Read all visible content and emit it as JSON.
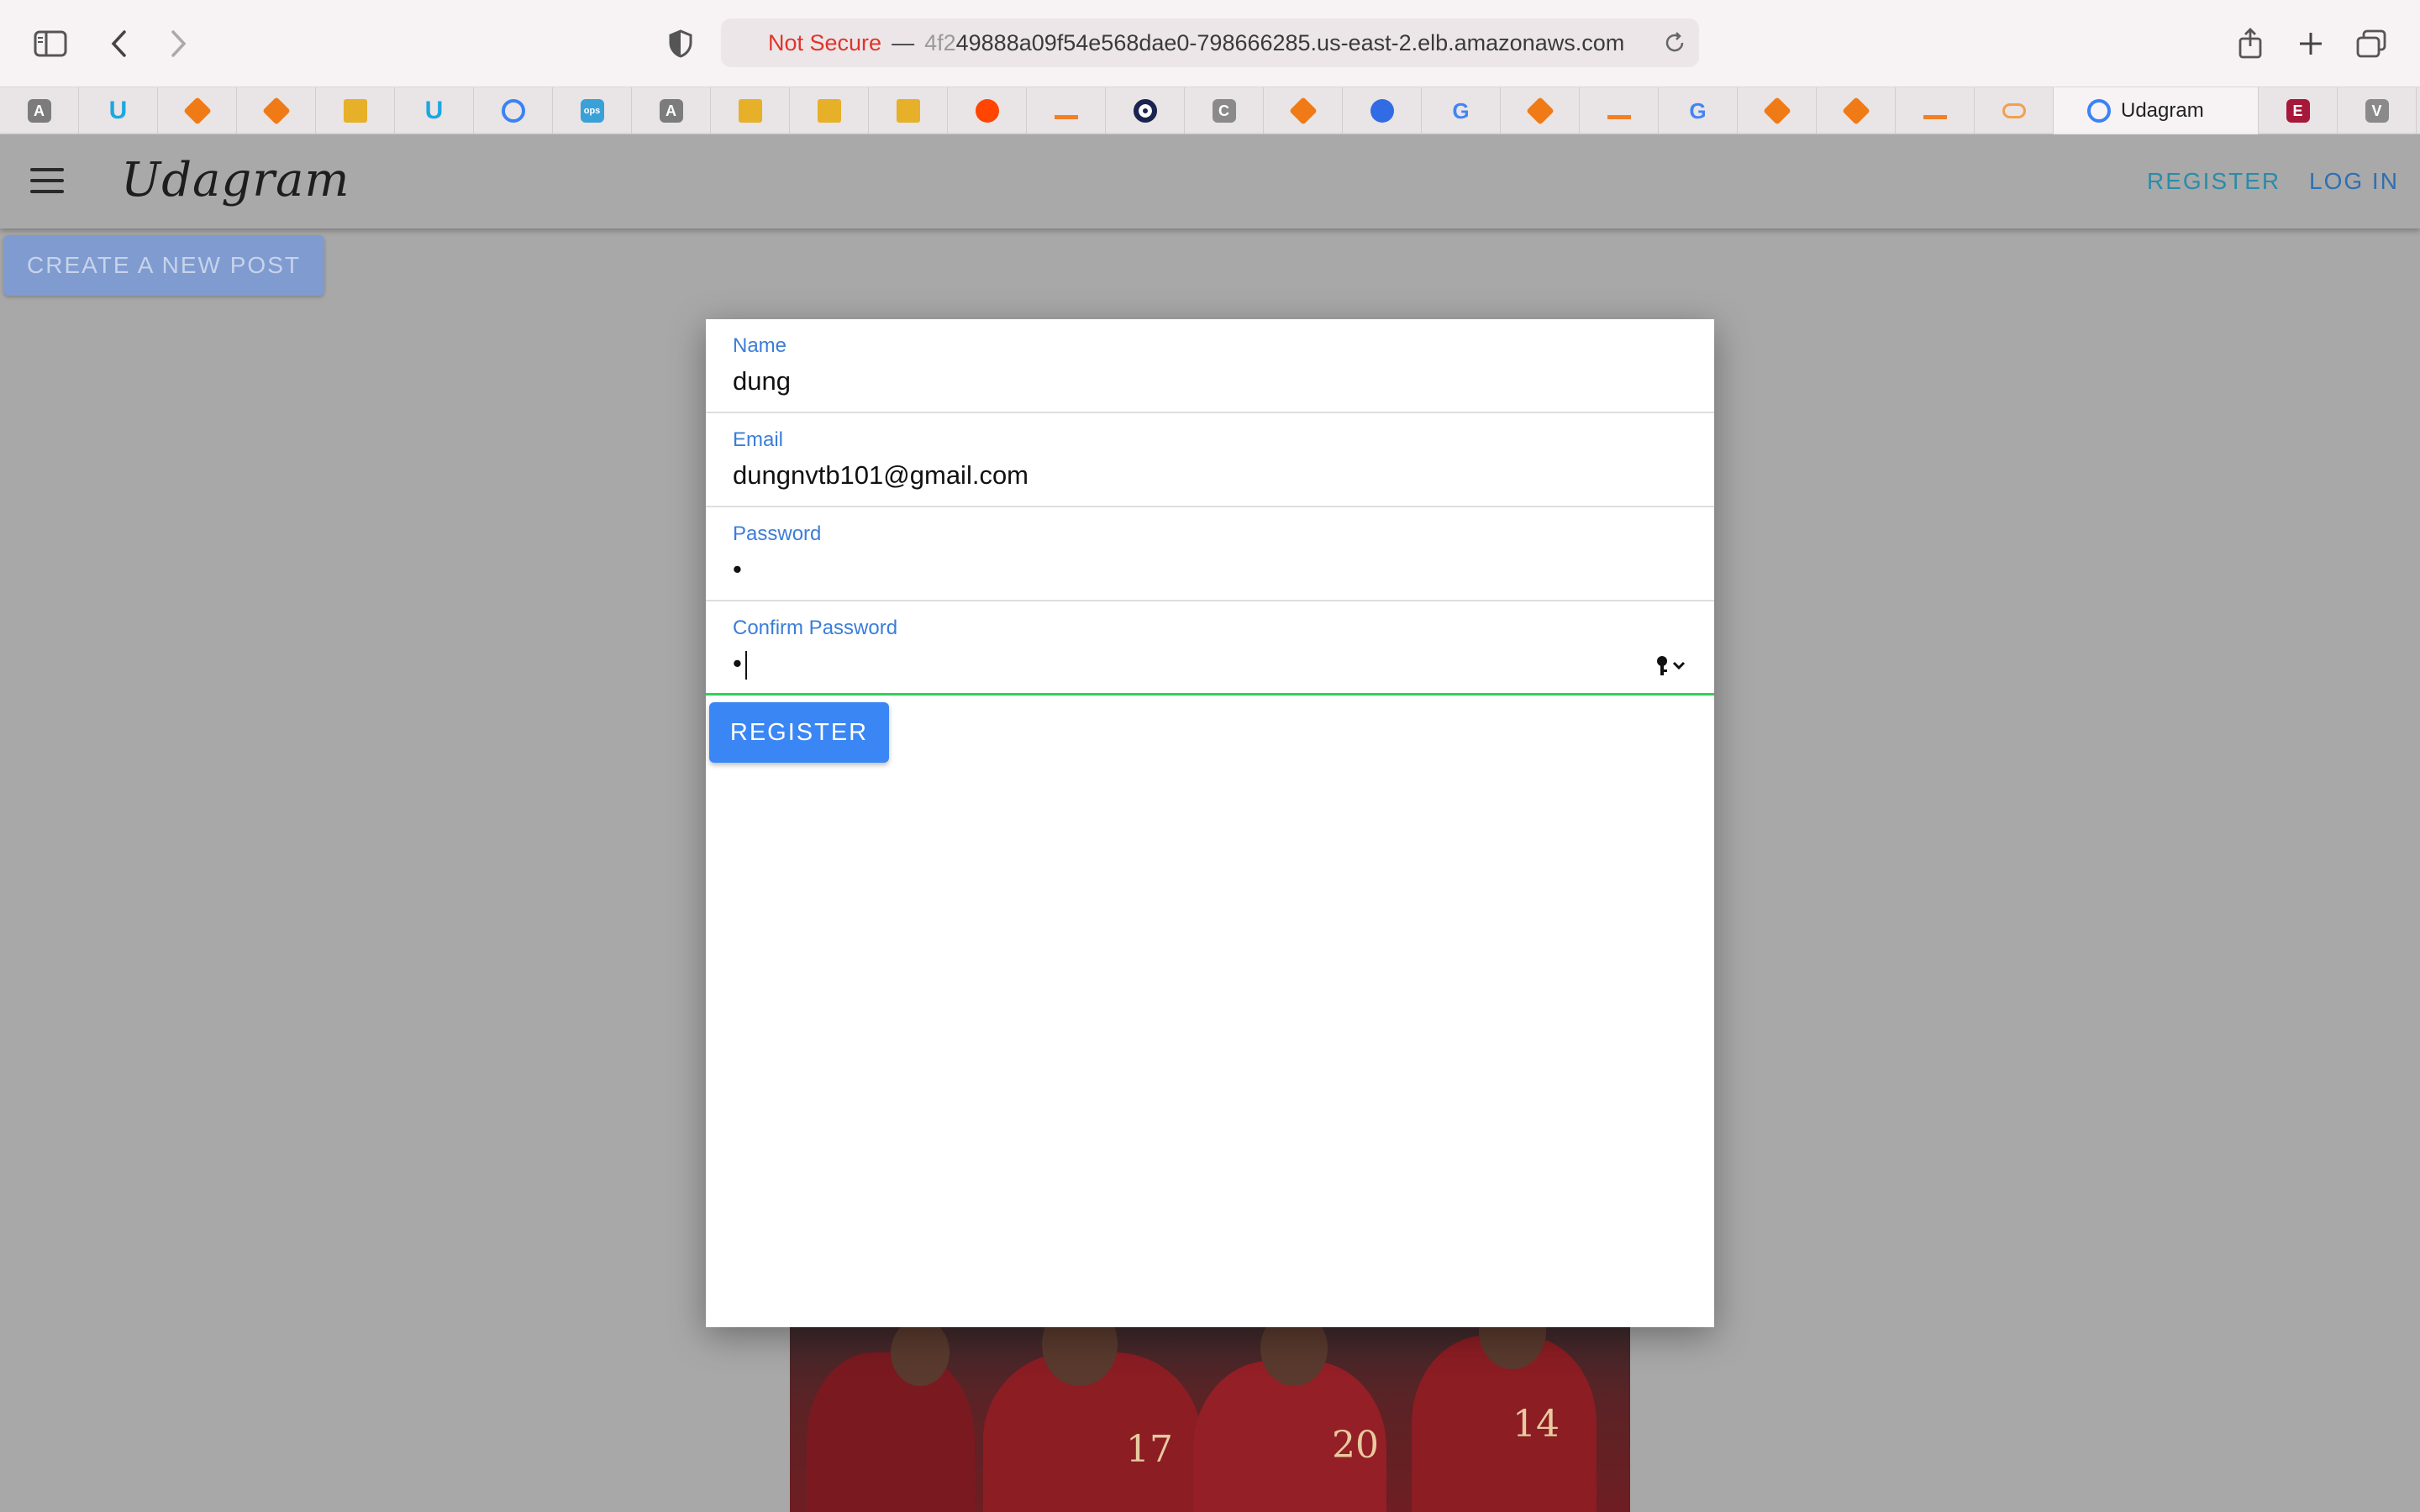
{
  "browser": {
    "address_bar": {
      "security_label": "Not Secure",
      "separator": "—",
      "host_prefix": "4f2",
      "host_rest": "49888a09f54e568dae0-798666285.us-east-2.elb.amazonaws.com"
    },
    "tabs": [
      {
        "icon": "letter-a-icon",
        "glyph": "A"
      },
      {
        "icon": "udacity-icon",
        "glyph": "U"
      },
      {
        "icon": "aws-cube-icon",
        "glyph": ""
      },
      {
        "icon": "aws-cube-icon",
        "glyph": ""
      },
      {
        "icon": "book-icon",
        "glyph": ""
      },
      {
        "icon": "udacity-icon",
        "glyph": "U"
      },
      {
        "icon": "circle-target-icon",
        "glyph": ""
      },
      {
        "icon": "ops-icon",
        "glyph": "ops"
      },
      {
        "icon": "letter-a-icon",
        "glyph": "A"
      },
      {
        "icon": "book-icon",
        "glyph": ""
      },
      {
        "icon": "book-icon",
        "glyph": ""
      },
      {
        "icon": "book-icon",
        "glyph": ""
      },
      {
        "icon": "reddit-icon",
        "glyph": ""
      },
      {
        "icon": "stackoverflow-icon",
        "glyph": ""
      },
      {
        "icon": "dark-circle-icon",
        "glyph": ""
      },
      {
        "icon": "letter-c-icon",
        "glyph": "C"
      },
      {
        "icon": "aws-cube-icon",
        "glyph": ""
      },
      {
        "icon": "kubernetes-icon",
        "glyph": ""
      },
      {
        "icon": "google-icon",
        "glyph": "G"
      },
      {
        "icon": "aws-cube-icon",
        "glyph": ""
      },
      {
        "icon": "stackoverflow-icon",
        "glyph": ""
      },
      {
        "icon": "google-icon",
        "glyph": "G"
      },
      {
        "icon": "aws-cube-icon",
        "glyph": ""
      },
      {
        "icon": "aws-cube-icon",
        "glyph": ""
      },
      {
        "icon": "stackoverflow-icon",
        "glyph": ""
      },
      {
        "icon": "cloud-icon",
        "glyph": ""
      }
    ],
    "active_tab": {
      "label": "Udagram",
      "icon": "ionic-icon"
    },
    "trailing_tabs": [
      {
        "icon": "e-book-icon",
        "glyph": "E"
      },
      {
        "icon": "letter-v-icon",
        "glyph": "V"
      }
    ]
  },
  "app": {
    "brand": "Udagram",
    "nav": {
      "register": "REGISTER",
      "login": "LOG IN"
    },
    "create_post": "CREATE A NEW POST"
  },
  "form": {
    "name": {
      "label": "Name",
      "value": "dung"
    },
    "email": {
      "label": "Email",
      "value": "dungnvtb101@gmail.com"
    },
    "password": {
      "label": "Password",
      "value": "•"
    },
    "confirm_password": {
      "label": "Confirm Password",
      "value": "•"
    },
    "submit": "REGISTER"
  },
  "photo": {
    "jersey_numbers": [
      "17",
      "20",
      "14"
    ]
  },
  "colors": {
    "accent": "#3a86f4",
    "focus": "#2fd158",
    "label": "#3b7dd8",
    "insecure": "#e0342b"
  }
}
